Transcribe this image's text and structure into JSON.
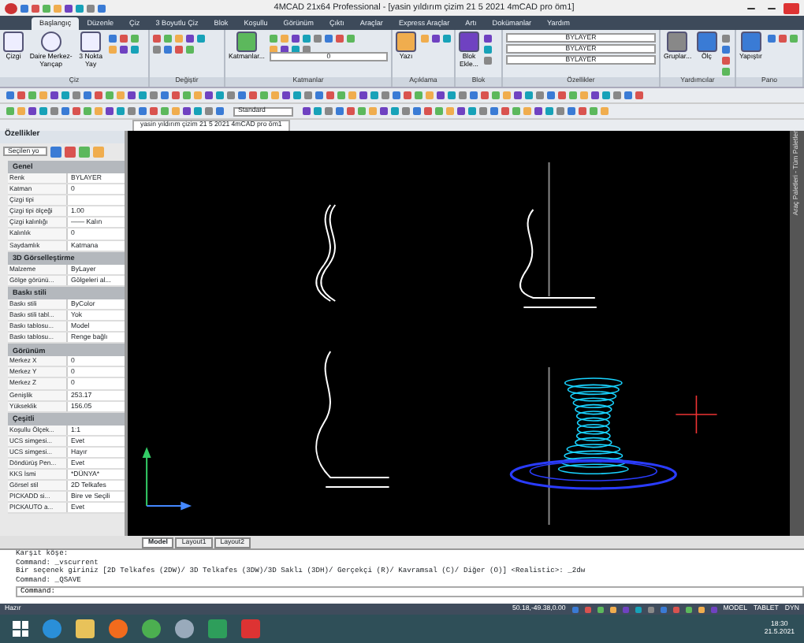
{
  "window": {
    "title": "4MCAD 21x64 Professional - [yasin yıldırım çizim 21 5 2021 4mCAD pro öm1]"
  },
  "ribbon": {
    "tabs": [
      {
        "label": "Başlangıç",
        "selected": true
      },
      {
        "label": "Düzenle",
        "selected": false
      },
      {
        "label": "Çiz",
        "selected": false
      },
      {
        "label": "3 Boyutlu Çiz",
        "selected": false
      },
      {
        "label": "Blok",
        "selected": false
      },
      {
        "label": "Koşullu",
        "selected": false
      },
      {
        "label": "Görünüm",
        "selected": false
      },
      {
        "label": "Çıktı",
        "selected": false
      },
      {
        "label": "Araçlar",
        "selected": false
      },
      {
        "label": "Express Araçlar",
        "selected": false
      },
      {
        "label": "Artı",
        "selected": false
      },
      {
        "label": "Dokümanlar",
        "selected": false
      },
      {
        "label": "Yardım",
        "selected": false
      }
    ],
    "panels": [
      {
        "label": "Çiz",
        "tools": [
          "Çizgi",
          "Daire Merkez-Yarıçap",
          "3 Nokta Yay"
        ]
      },
      {
        "label": "Değiştir"
      },
      {
        "label": "Katmanlar",
        "tools": [
          "Katmanlar..."
        ],
        "dropdowns": [
          "0"
        ]
      },
      {
        "label": "Açıklama",
        "tools": [
          "Yazı"
        ]
      },
      {
        "label": "Blok",
        "tools": [
          "Blok Ekle..."
        ]
      },
      {
        "label": "Özellikler",
        "dropdowns": [
          "BYLAYER",
          "BYLAYER",
          "BYLAYER"
        ]
      },
      {
        "label": "Yardımcılar",
        "tools": [
          "Gruplar...",
          "Ölç"
        ]
      },
      {
        "label": "Pano",
        "tools": [
          "Yapıştır"
        ]
      }
    ]
  },
  "toolbar": {
    "style_dropdown": "Standard"
  },
  "document_tab": "yasin yıldırım çizim 21 5 2021 4mCAD pro öm1",
  "properties": {
    "title": "Özellikler",
    "selector": "Seçilen yo",
    "groups": [
      {
        "label": "Genel",
        "rows": [
          {
            "label": "Renk",
            "value": "BYLAYER"
          },
          {
            "label": "Katman",
            "value": "0"
          },
          {
            "label": "Çizgi tipi"
          },
          {
            "label": "Çizgi tipi ölçeği",
            "value": "1.00"
          },
          {
            "label": "Çizgi kalınlığı",
            "value": "—— Kalın"
          },
          {
            "label": "Kalınlık",
            "value": "0"
          },
          {
            "label": "Saydamlık",
            "value": "Katmana"
          }
        ]
      },
      {
        "label": "3D Görselleştirme",
        "rows": [
          {
            "label": "Malzeme",
            "value": "ByLayer"
          },
          {
            "label": "Gölge görünü...",
            "value": "Gölgeleri al..."
          }
        ]
      },
      {
        "label": "Baskı stili",
        "rows": [
          {
            "label": "Baskı stili",
            "value": "ByColor"
          },
          {
            "label": "Baskı stili tabl...",
            "value": "Yok"
          },
          {
            "label": "Baskı tablosu...",
            "value": "Model"
          },
          {
            "label": "Baskı tablosu...",
            "value": "Renge bağlı"
          }
        ]
      },
      {
        "label": "Görünüm",
        "rows": [
          {
            "label": "Merkez X",
            "value": "0"
          },
          {
            "label": "Merkez Y",
            "value": "0"
          },
          {
            "label": "Merkez Z",
            "value": "0"
          },
          {
            "label": "Genişlik",
            "value": "253.17"
          },
          {
            "label": "Yükseklik",
            "value": "156.05"
          }
        ]
      },
      {
        "label": "Çeşitli",
        "rows": [
          {
            "label": "Koşullu Ölçek...",
            "value": "1:1"
          },
          {
            "label": "UCS simgesi...",
            "value": "Evet"
          },
          {
            "label": "UCS simgesi...",
            "value": "Hayır"
          },
          {
            "label": "Döndürüş Pen...",
            "value": "Evet"
          },
          {
            "label": "KKS İsmi",
            "value": "*DÜNYA*"
          },
          {
            "label": "Görsel stil",
            "value": "2D Telkafes"
          },
          {
            "label": "PICKADD si...",
            "value": "Bire ve Seçili"
          },
          {
            "label": "PICKAUTO a...",
            "value": "Evet"
          }
        ]
      }
    ]
  },
  "palette_title": "Araç Paletleri - Tüm Paletler",
  "layout_tabs": [
    {
      "label": "Model",
      "selected": true
    },
    {
      "label": "Layout1",
      "selected": false
    },
    {
      "label": "Layout2",
      "selected": false
    }
  ],
  "command_history": [
    "Karşıt köşe:",
    "Command: _vscurrent",
    "Bir seçenek giriniz [2D Telkafes (2DW)/ 3D Telkafes (3DW)/3D Saklı (3DH)/ Gerçekçi (R)/ Kavramsal (C)/ Diğer (O)] <Realistic>: _2dw",
    "Command: _QSAVE"
  ],
  "command_prompt": "Command:",
  "status_bar": {
    "state": "Hazır",
    "coordinates": "50.18,-49.38,0.00",
    "modes": [
      "MODEL",
      "TABLET",
      "DYN"
    ]
  },
  "taskbar": {
    "time": "18:30",
    "date": "21.5.2021"
  }
}
